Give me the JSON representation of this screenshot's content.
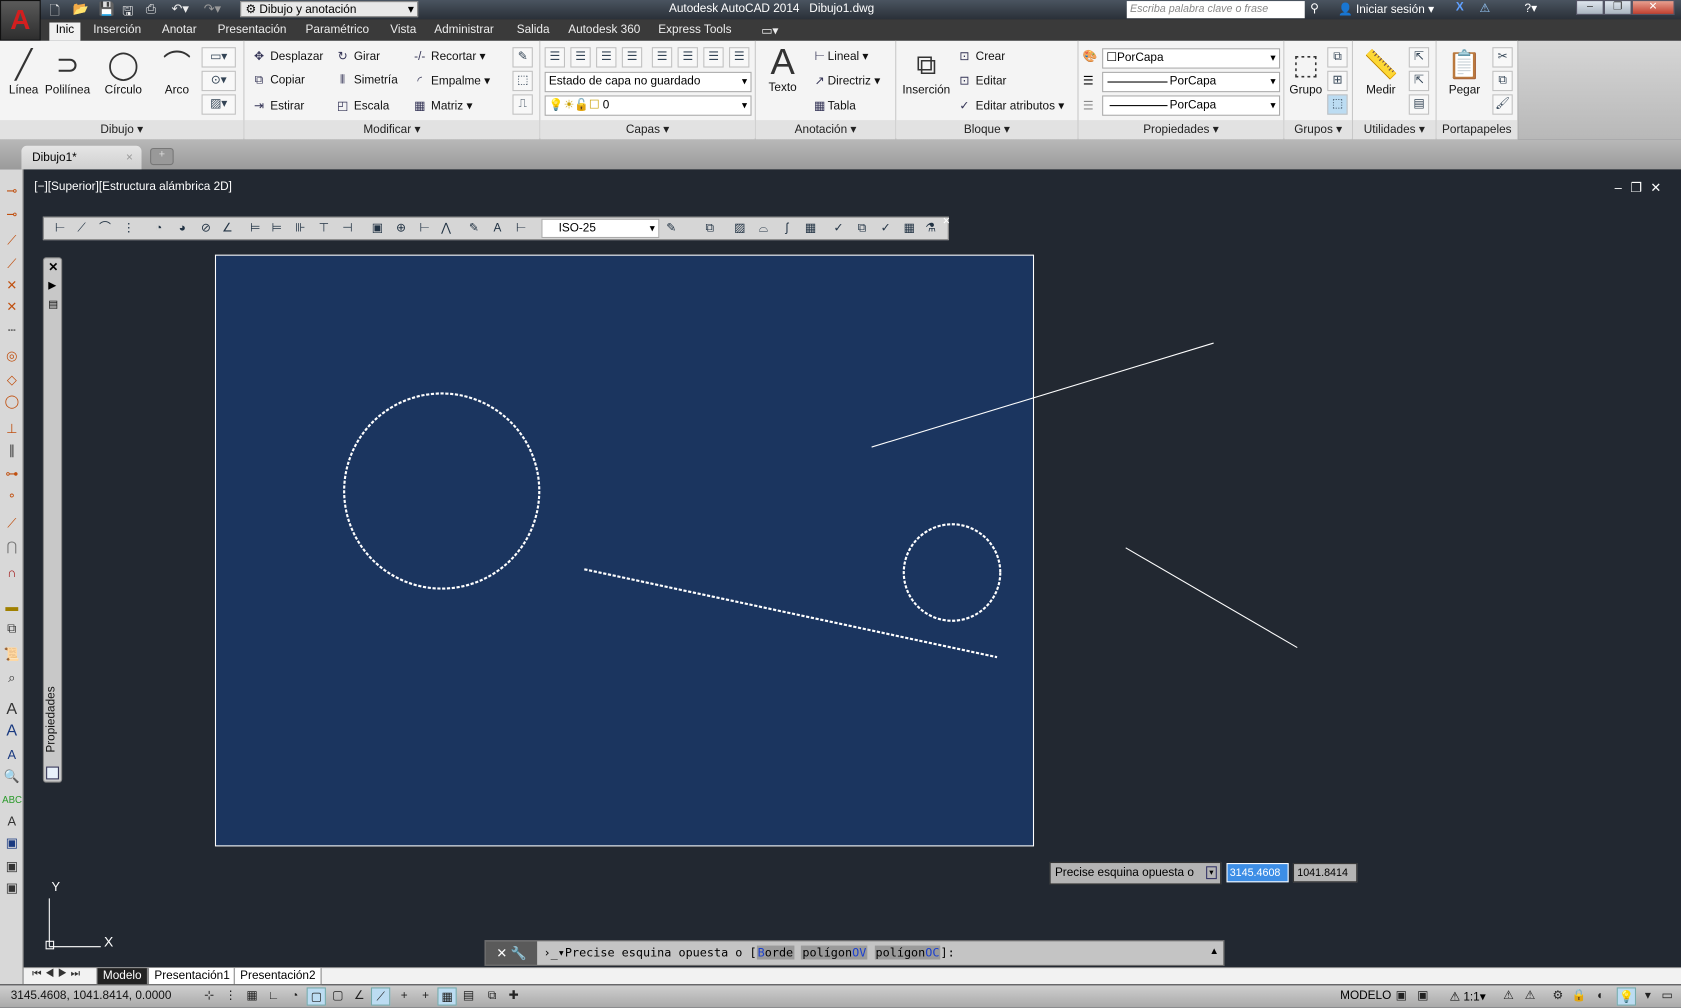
{
  "titlebar": {
    "app_title": "Autodesk AutoCAD 2014",
    "file_name": "Dibujo1.dwg",
    "workspace": "Dibujo y anotación",
    "search_placeholder": "Escriba palabra clave o frase",
    "sign_in": "Iniciar sesión",
    "app_logo": "A"
  },
  "ribbon_tabs": [
    "Inic",
    "Inserción",
    "Anotar",
    "Presentación",
    "Paramétrico",
    "Vista",
    "Administrar",
    "Salida",
    "Autodesk 360",
    "Express Tools"
  ],
  "ribbon": {
    "dibujo": {
      "title": "Dibujo",
      "items": [
        "Línea",
        "Polilínea",
        "Círculo",
        "Arco"
      ]
    },
    "modificar": {
      "title": "Modificar",
      "items": [
        "Desplazar",
        "Girar",
        "Recortar",
        "Copiar",
        "Simetría",
        "Empalme",
        "Estirar",
        "Escala",
        "Matriz"
      ]
    },
    "capas": {
      "title": "Capas",
      "layer_state": "Estado de capa no guardado",
      "current_layer": "0"
    },
    "anotacion": {
      "title": "Anotación",
      "text": "Texto",
      "items": [
        "Lineal",
        "Directriz",
        "Tabla"
      ]
    },
    "bloque": {
      "title": "Bloque",
      "insert": "Inserción",
      "items": [
        "Crear",
        "Editar",
        "Editar atributos"
      ]
    },
    "propiedades": {
      "title": "Propiedades",
      "color": "PorCapa",
      "lineweight": "PorCapa",
      "linetype": "PorCapa"
    },
    "grupos": {
      "title": "Grupos",
      "group": "Grupo"
    },
    "utilidades": {
      "title": "Utilidades",
      "measure": "Medir"
    },
    "portapapeles": {
      "title": "Portapapeles",
      "paste": "Pegar"
    }
  },
  "document_tab": "Dibujo1*",
  "viewport_label": "[−][Superior][Estructura alámbrica 2D]",
  "dim_style": "ISO-25",
  "properties_palette": "Propiedades",
  "ucs": {
    "x": "X",
    "y": "Y"
  },
  "dynamic_input": {
    "prompt": "Precise esquina opuesta o",
    "x": "3145.4608",
    "y": "1041.8414"
  },
  "command_line": {
    "prefix": "Precise esquina opuesta o [",
    "opt1_key": "B",
    "opt1": "orde",
    "opt2": "polígon",
    "opt2_key": "OV",
    "opt3": "polígon",
    "opt3_key": "OC",
    "suffix": "]:"
  },
  "layout_tabs": [
    "Modelo",
    "Presentación1",
    "Presentación2"
  ],
  "status": {
    "coordinates": "3145.4608, 1041.8414, 0.0000",
    "space": "MODELO",
    "scale": "1:1"
  },
  "colors": {
    "drawing_bg": "#222831",
    "selection_fill": "#1b355f",
    "accent": "#3d8ee6"
  }
}
